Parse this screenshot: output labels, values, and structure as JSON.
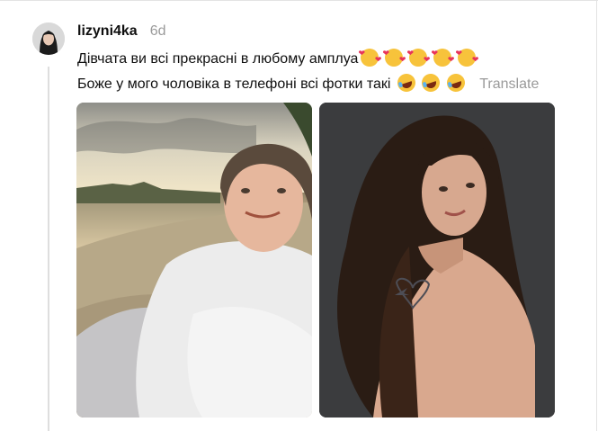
{
  "post": {
    "username": "lizyni4ka",
    "time": "6d",
    "line1": "Дівчата ви всі прекрасні в любому амплуа",
    "line2": "Боже у мого чоловіка в телефоні всі фотки такі",
    "translate_label": "Translate"
  },
  "icons": {
    "line1_emojis": [
      "smiling-face-with-hearts",
      "smiling-face-with-hearts",
      "smiling-face-with-hearts",
      "smiling-face-with-hearts",
      "smiling-face-with-hearts"
    ],
    "line2_emojis": [
      "rolling-on-floor-laughing",
      "rolling-on-floor-laughing",
      "rolling-on-floor-laughing"
    ]
  }
}
